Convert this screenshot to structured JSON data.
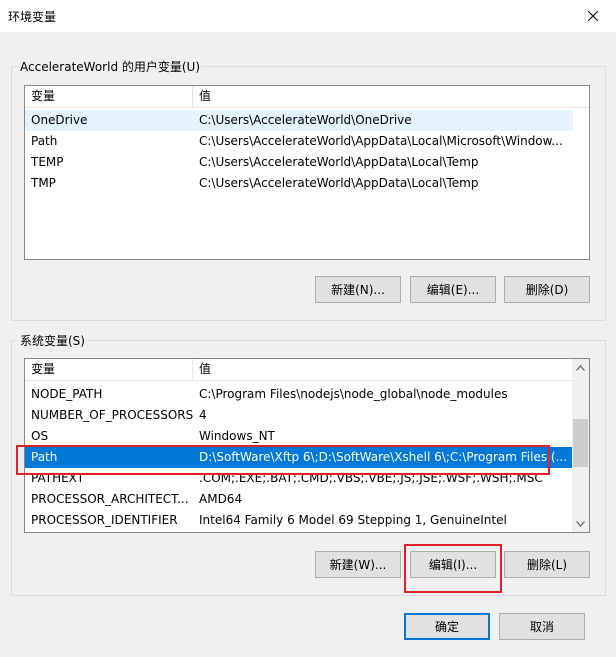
{
  "window": {
    "title": "环境变量",
    "close_icon": "close-icon"
  },
  "user_vars": {
    "group_label": "AccelerateWorld 的用户变量(U)",
    "columns": [
      "变量",
      "值"
    ],
    "rows": [
      {
        "name": "OneDrive",
        "value": "C:\\Users\\AccelerateWorld\\OneDrive"
      },
      {
        "name": "Path",
        "value": "C:\\Users\\AccelerateWorld\\AppData\\Local\\Microsoft\\Window..."
      },
      {
        "name": "TEMP",
        "value": "C:\\Users\\AccelerateWorld\\AppData\\Local\\Temp"
      },
      {
        "name": "TMP",
        "value": "C:\\Users\\AccelerateWorld\\AppData\\Local\\Temp"
      }
    ],
    "buttons": {
      "new": "新建(N)...",
      "edit": "编辑(E)...",
      "delete": "删除(D)"
    }
  },
  "system_vars": {
    "group_label": "系统变量(S)",
    "columns": [
      "变量",
      "值"
    ],
    "rows": [
      {
        "name": "NODE_PATH",
        "value": "C:\\Program Files\\nodejs\\node_global\\node_modules"
      },
      {
        "name": "NUMBER_OF_PROCESSORS",
        "value": "4"
      },
      {
        "name": "OS",
        "value": "Windows_NT"
      },
      {
        "name": "Path",
        "value": "D:\\SoftWare\\Xftp 6\\;D:\\SoftWare\\Xshell 6\\;C:\\Program Files (..."
      },
      {
        "name": "PATHEXT",
        "value": ".COM;.EXE;.BAT;.CMD;.VBS;.VBE;.JS;.JSE;.WSF;.WSH;.MSC"
      },
      {
        "name": "PROCESSOR_ARCHITECT...",
        "value": "AMD64"
      },
      {
        "name": "PROCESSOR_IDENTIFIER",
        "value": "Intel64 Family 6 Model 69 Stepping 1, GenuineIntel"
      }
    ],
    "selected_row": "Path",
    "buttons": {
      "new": "新建(W)...",
      "edit": "编辑(I)...",
      "delete": "删除(L)"
    }
  },
  "footer": {
    "ok": "确定",
    "cancel": "取消"
  },
  "colors": {
    "selection": "#0078d7",
    "hover": "#e5f3ff",
    "highlight_box": "#e0202a",
    "window_bg": "#f0f0f0"
  }
}
